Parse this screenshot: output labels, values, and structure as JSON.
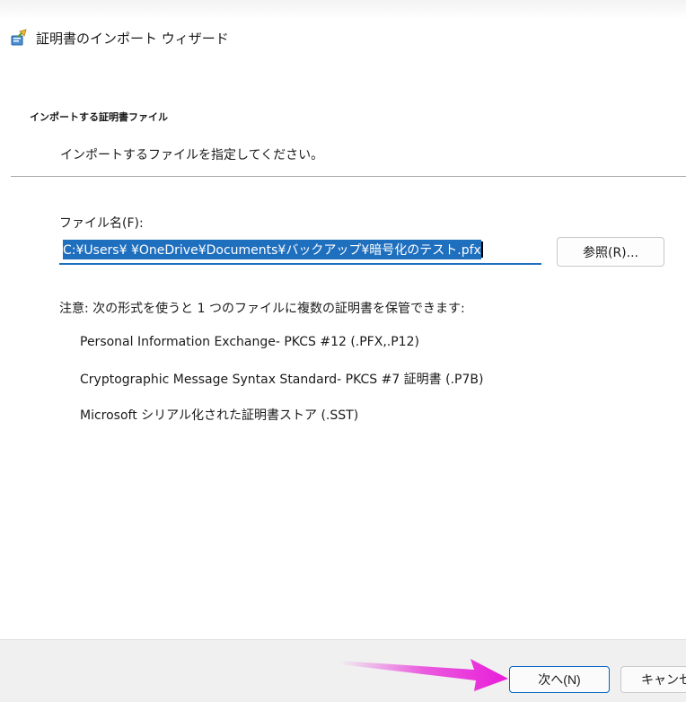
{
  "window": {
    "title": "証明書のインポート ウィザード",
    "icon": "certificate-wizard-icon"
  },
  "header": {
    "title": "インポートする証明書ファイル",
    "subtitle": "インポートするファイルを指定してください。"
  },
  "file": {
    "label": "ファイル名(F):",
    "value": "C:¥Users¥        ¥OneDrive¥Documents¥バックアップ¥暗号化のテスト.pfx",
    "browse_label": "参照(R)..."
  },
  "note": "注意: 次の形式を使うと 1 つのファイルに複数の証明書を保管できます:",
  "formats": [
    "Personal Information Exchange- PKCS #12 (.PFX,.P12)",
    "Cryptographic Message Syntax Standard- PKCS #7 証明書 (.P7B)",
    "Microsoft シリアル化された証明書ストア (.SST)"
  ],
  "footer": {
    "next_label": "次へ(N)",
    "cancel_label": "キャンセル"
  },
  "colors": {
    "accent": "#1f6fbf",
    "arrow": "#e81cd8"
  }
}
